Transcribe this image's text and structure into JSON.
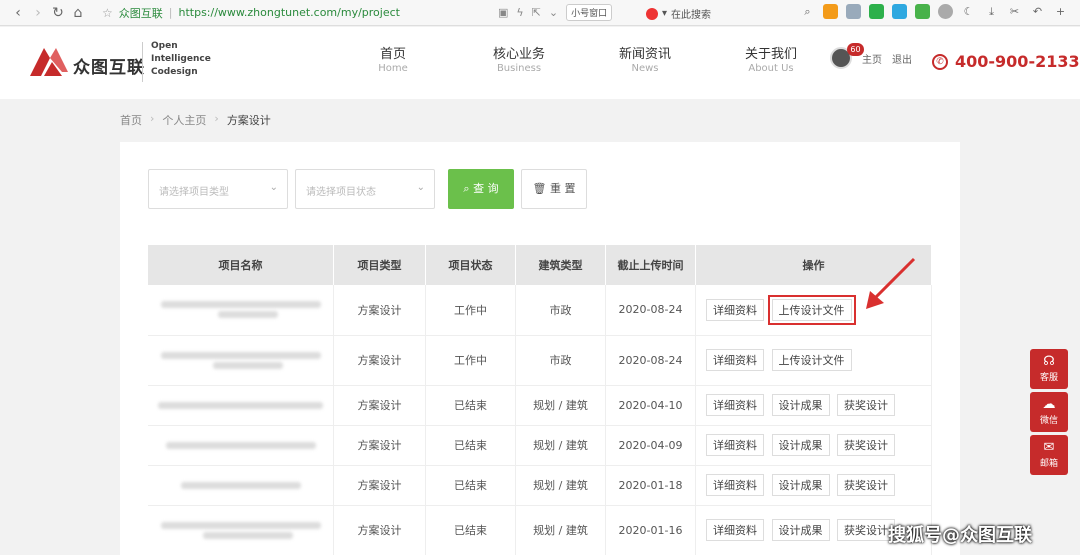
{
  "browser": {
    "url_site": "众图互联",
    "url": "https://www.zhongtunet.com/my/project",
    "small_window": "小号窗口",
    "search_placeholder": "在此搜索"
  },
  "header": {
    "logo_cn": "众图互联",
    "logo_en": [
      "Open",
      "Intelligence",
      "Codesign"
    ],
    "nav": [
      {
        "cn": "首页",
        "en": "Home"
      },
      {
        "cn": "核心业务",
        "en": "Business"
      },
      {
        "cn": "新闻资讯",
        "en": "News"
      },
      {
        "cn": "关于我们",
        "en": "About Us"
      }
    ],
    "badge_count": "60",
    "user_home": "主页",
    "user_logout": "退出",
    "phone": "400-900-2133",
    "brand_color": "#c62b2b"
  },
  "breadcrumb": {
    "home": "首页",
    "personal": "个人主页",
    "current": "方案设计"
  },
  "filters": {
    "type_placeholder": "请选择项目类型",
    "status_placeholder": "请选择项目状态",
    "query_label": "查 询",
    "reset_label": "重 置",
    "query_color": "#6bc04b"
  },
  "table": {
    "headers": [
      "项目名称",
      "项目类型",
      "项目状态",
      "建筑类型",
      "截止上传时间",
      "操作"
    ],
    "rows": [
      {
        "type": "方案设计",
        "status": "工作中",
        "building": "市政",
        "deadline": "2020-08-24",
        "ops": [
          "详细资料",
          "上传设计文件"
        ]
      },
      {
        "type": "方案设计",
        "status": "工作中",
        "building": "市政",
        "deadline": "2020-08-24",
        "ops": [
          "详细资料",
          "上传设计文件"
        ]
      },
      {
        "type": "方案设计",
        "status": "已结束",
        "building": "规划 / 建筑",
        "deadline": "2020-04-10",
        "ops": [
          "详细资料",
          "设计成果",
          "获奖设计"
        ]
      },
      {
        "type": "方案设计",
        "status": "已结束",
        "building": "规划 / 建筑",
        "deadline": "2020-04-09",
        "ops": [
          "详细资料",
          "设计成果",
          "获奖设计"
        ]
      },
      {
        "type": "方案设计",
        "status": "已结束",
        "building": "规划 / 建筑",
        "deadline": "2020-01-18",
        "ops": [
          "详细资料",
          "设计成果",
          "获奖设计"
        ]
      },
      {
        "type": "方案设计",
        "status": "已结束",
        "building": "规划 / 建筑",
        "deadline": "2020-01-16",
        "ops": [
          "详细资料",
          "设计成果",
          "获奖设计"
        ]
      }
    ]
  },
  "float_bar": {
    "service": "客服",
    "wechat": "微信",
    "mail": "邮箱"
  },
  "watermark": "搜狐号@众图互联"
}
